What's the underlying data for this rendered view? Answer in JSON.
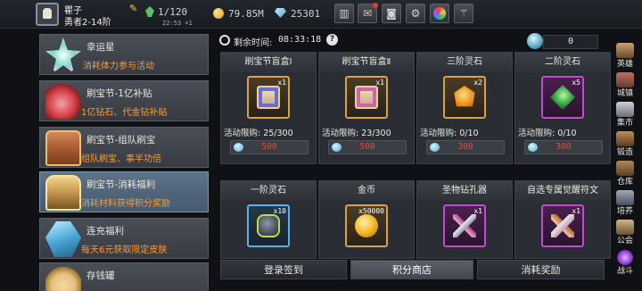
{
  "player": {
    "name": "瞿子",
    "rank": "勇者2-14阶",
    "stamina": "1/120",
    "stamina_timer": "22:53 +1"
  },
  "currency": {
    "gold": "79.85M",
    "diamond": "25301"
  },
  "toolbar": [
    "shop-icon",
    "mail-icon",
    "gamepad-icon",
    "gear-icon",
    "color-wheel-icon",
    "wand-icon"
  ],
  "left_menu": [
    {
      "title": "幸运星",
      "desc": "消耗体力参与活动",
      "icon": "star-icon",
      "color": "#7fd8c8"
    },
    {
      "title": "刷宝节-1亿补贴",
      "desc": "1亿钻石、代金钻补贴",
      "icon": "sack-icon",
      "color": "#d8454a"
    },
    {
      "title": "刷宝节-组队刷宝",
      "desc": "组队刷宝、事半功倍",
      "icon": "chest-icon",
      "color": "#b0633a"
    },
    {
      "title": "刷宝节-消耗福利",
      "desc": "消耗材料获得积分奖励",
      "icon": "open-chest-icon",
      "color": "#c89a52"
    },
    {
      "title": "连充福利",
      "desc": "每天6元获取限定皮肤",
      "icon": "crystal-icon",
      "color": "#4aa8d8"
    },
    {
      "title": "存钱罐",
      "desc": "",
      "icon": "piggy-icon",
      "color": "#e6c07a"
    }
  ],
  "countdown": {
    "label": "剩余时间:",
    "time": "08:33:18"
  },
  "points": "0",
  "shop_items": [
    {
      "name": "刷宝节盲盒Ⅰ",
      "count": "x1",
      "limit": "活动限购: 25/300",
      "price": "500",
      "frame": "gold",
      "art": "box-blue"
    },
    {
      "name": "刷宝节盲盒Ⅱ",
      "count": "x1",
      "limit": "活动限购: 23/300",
      "price": "500",
      "frame": "gold",
      "art": "box-pink"
    },
    {
      "name": "三阶灵石",
      "count": "x2",
      "limit": "活动限购: 0/10",
      "price": "300",
      "frame": "gold",
      "art": "orange-stone"
    },
    {
      "name": "二阶灵石",
      "count": "x5",
      "limit": "活动限购: 0/10",
      "price": "300",
      "frame": "purple",
      "art": "green-stone"
    },
    {
      "name": "一阶灵石",
      "count": "x10",
      "frame": "blue",
      "art": "dark-stone"
    },
    {
      "name": "金币",
      "count": "x50000",
      "frame": "gold",
      "art": "gold-coin"
    },
    {
      "name": "圣物钻孔器",
      "count": "x1",
      "frame": "purple",
      "art": "drill"
    },
    {
      "name": "自选专属觉醒符文",
      "count": "x1",
      "frame": "purple",
      "art": "rune"
    }
  ],
  "tabs": [
    "登录签到",
    "积分商店",
    "消耗奖励"
  ],
  "active_tab": 1,
  "sidebar": [
    {
      "label": "英雄",
      "icon": "hero-icon"
    },
    {
      "label": "城镇",
      "icon": "town-icon"
    },
    {
      "label": "集市",
      "icon": "market-icon"
    },
    {
      "label": "锻造",
      "icon": "forge-icon"
    },
    {
      "label": "仓库",
      "icon": "warehouse-icon"
    },
    {
      "label": "培养",
      "icon": "train-icon"
    },
    {
      "label": "公会",
      "icon": "guild-icon"
    },
    {
      "label": "战斗",
      "icon": "battle-icon"
    }
  ]
}
